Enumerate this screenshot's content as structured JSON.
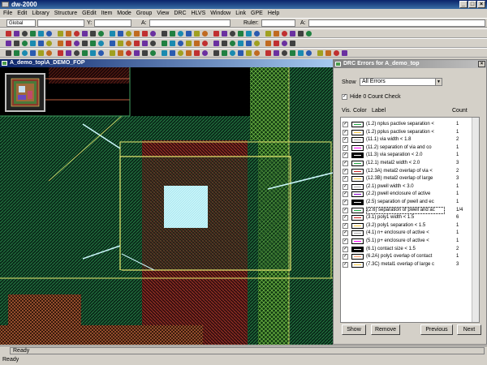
{
  "app": {
    "title": "dw-2000"
  },
  "menu": [
    "File",
    "Edit",
    "Library",
    "Structure",
    "GEdit",
    "Item",
    "Mode",
    "Group",
    "View",
    "DRC",
    "HLVS",
    "Window",
    "Link",
    "GPE",
    "Help"
  ],
  "toolbar": {
    "layer_combo": "Global",
    "y_label": "Y:",
    "a_label_1": "A:",
    "ruler_label": "Ruler:",
    "a_label_2": "A:"
  },
  "canvas": {
    "title": "A_demo_top\\A_DEMO_FOP"
  },
  "drc": {
    "title": "DRC Errors for A_demo_top",
    "show_label": "Show",
    "show_value": "All Errors",
    "hide_zero_label": "Hide 0 Count Check",
    "hide_zero_checked": "✓",
    "col_vis": "Vis.",
    "col_color": "Color",
    "col_label": "Label",
    "col_count": "Count",
    "errors": [
      {
        "check": "✓",
        "color": "#22aa44",
        "label": "(1.2) nplus pactive separation <",
        "count": "1"
      },
      {
        "check": "✓",
        "color": "#ffcc44",
        "label": "(1.2) pplus pactive separation <",
        "count": "1"
      },
      {
        "check": "✓",
        "color": "#aaaaaa",
        "label": "(11.1) via width < 1.8",
        "count": "2"
      },
      {
        "check": "✓",
        "color": "#ff00ff",
        "label": "(11.2) separation of via and co",
        "count": "1"
      },
      {
        "check": "✓",
        "color": "#ffffff",
        "label": "(11.3) via separation < 2.0",
        "count": "1"
      },
      {
        "check": "✓",
        "color": "#22aa44",
        "label": "(12.1) metal2 width < 2.0",
        "count": "3"
      },
      {
        "check": "✓",
        "color": "#cc2222",
        "label": "(12.3A) metal2 overlap of via <",
        "count": "2"
      },
      {
        "check": "✓",
        "color": "#ffcc44",
        "label": "(12.3B) metal2 overlap of large",
        "count": "3"
      },
      {
        "check": "✓",
        "color": "#aaaaaa",
        "label": "(2.1) pwell width < 3.0",
        "count": "1"
      },
      {
        "check": "✓",
        "color": "#8800cc",
        "label": "(2.2) pwell enclosure of active",
        "count": "1"
      },
      {
        "check": "✓",
        "color": "#ffffff",
        "label": "(2.5) separation of pwell and ec",
        "count": "1"
      },
      {
        "check": "✓",
        "color": "#22aa44",
        "label": "(2.6) separation of pwell and ac",
        "count": "1/4"
      },
      {
        "check": "✓",
        "color": "#cc2222",
        "label": "(3.1) poly1 width < 1.5",
        "count": "6"
      },
      {
        "check": "✓",
        "color": "#ffcc44",
        "label": "(3.2) poly1 separation < 1.5",
        "count": "1"
      },
      {
        "check": "✓",
        "color": "#aaaaaa",
        "label": "(4.1) n+ enclosure of active < ",
        "count": "1"
      },
      {
        "check": "✓",
        "color": "#ff00ff",
        "label": "(5.1) p+ enclosure of active < ",
        "count": "1"
      },
      {
        "check": "✓",
        "color": "#ffffff",
        "label": "(6.1) contact size < 1.5",
        "count": "2"
      },
      {
        "check": "✓",
        "color": "#ff9966",
        "label": "(6.2A) poly1 overlap of contact",
        "count": "1"
      },
      {
        "check": "✓",
        "color": "#ffcc44",
        "label": "(7.3C) metal1 overlap of large c",
        "count": "3"
      }
    ],
    "selected_index": 11,
    "buttons": {
      "show": "Show",
      "remove": "Remove",
      "previous": "Previous",
      "next": "Next"
    }
  },
  "status": {
    "line": "Ready",
    "bottom": "Ready"
  }
}
